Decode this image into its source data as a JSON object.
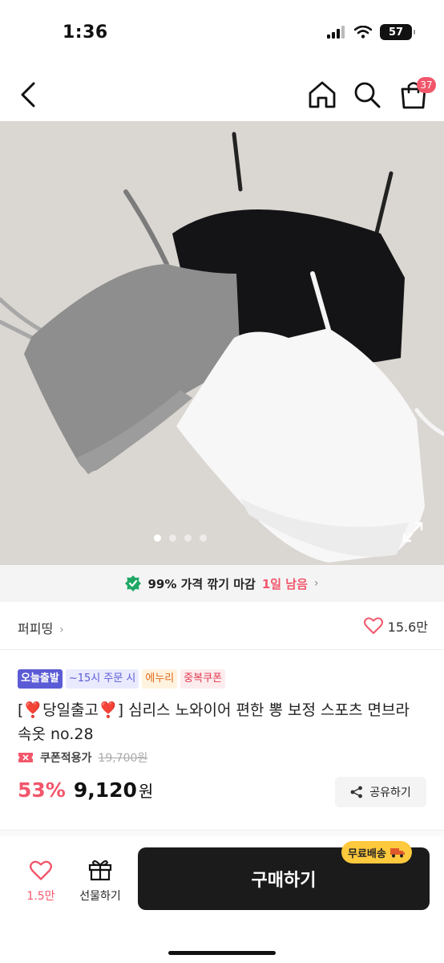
{
  "status": {
    "time": "1:36",
    "battery": "57"
  },
  "nav": {
    "cart_count": "37"
  },
  "deal": {
    "text": "99% 가격 깎기 마감",
    "remaining": "1일 남음",
    "arrow": "›"
  },
  "store": {
    "name": "퍼피띵",
    "likes": "15.6만"
  },
  "tags": [
    "오늘출발",
    "~15시 주문 시",
    "에누리",
    "중복쿠폰"
  ],
  "product": {
    "title": "[❣️당일출고❣️] 심리스 노와이어 편한 뽕 보정 스포츠 면브라 속옷 no.28",
    "coupon_label": "쿠폰적용가",
    "original_price": "19,700원",
    "discount": "53%",
    "price": "9,120",
    "currency": "원"
  },
  "share": {
    "label": "공유하기"
  },
  "bottom": {
    "wish_count": "1.5만",
    "gift_label": "선물하기",
    "buy_label": "구매하기",
    "free_shipping": "무료배송"
  },
  "colors": {
    "accent": "#f2566b",
    "buy_bg": "#1b1b1b",
    "shipping_bg": "#ffc93d",
    "tag_today": "#5b5bd6"
  },
  "icons": [
    "back-icon",
    "home-icon",
    "search-icon",
    "cart-icon",
    "expand-icon",
    "check-shield-icon",
    "heart-icon",
    "share-icon",
    "gift-icon",
    "coupon-icon",
    "truck-icon"
  ]
}
